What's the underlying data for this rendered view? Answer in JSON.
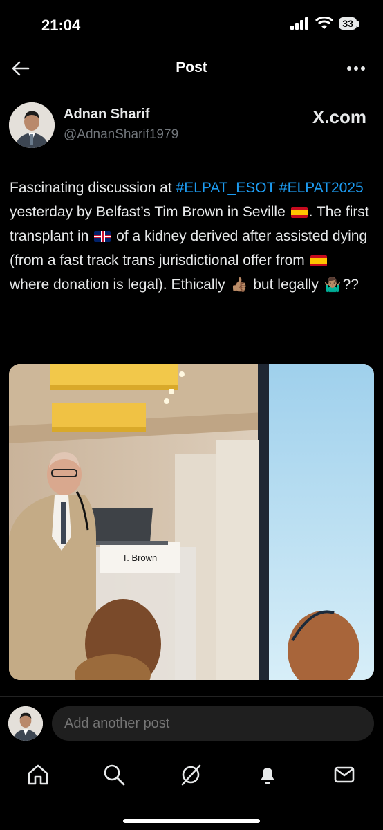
{
  "status_bar": {
    "time": "21:04",
    "battery": "33"
  },
  "header": {
    "title": "Post"
  },
  "post": {
    "author_name": "Adnan Sharif",
    "author_handle": "@AdnanSharif1979",
    "source": "X.com",
    "text": {
      "t1": "Fascinating discussion at ",
      "hashtag1": "#ELPAT_ESOT",
      "hashtag2": "#ELPAT2025",
      "t2": " yesterday by Belfast’s Tim Brown in Seville ",
      "t3": ". The first transplant in ",
      "t4": " of a kidney derived after assisted dying (from a fast track trans jurisdictional offer from ",
      "t5": " where donation is legal). Ethically ",
      "t6": " but legally ",
      "t7": "??"
    },
    "emojis": {
      "thumbs": "👍🏽",
      "shrug": "🤷🏽‍♂️"
    },
    "image": {
      "name_card": "T. Brown"
    }
  },
  "reply": {
    "placeholder": "Add another post"
  },
  "tabs": [
    "home-icon",
    "search-icon",
    "grok-icon",
    "notifications-icon",
    "messages-icon"
  ],
  "colors": {
    "accent": "#1d9bf0",
    "text": "#e7e9ea",
    "muted": "#71767b",
    "background": "#000000"
  }
}
